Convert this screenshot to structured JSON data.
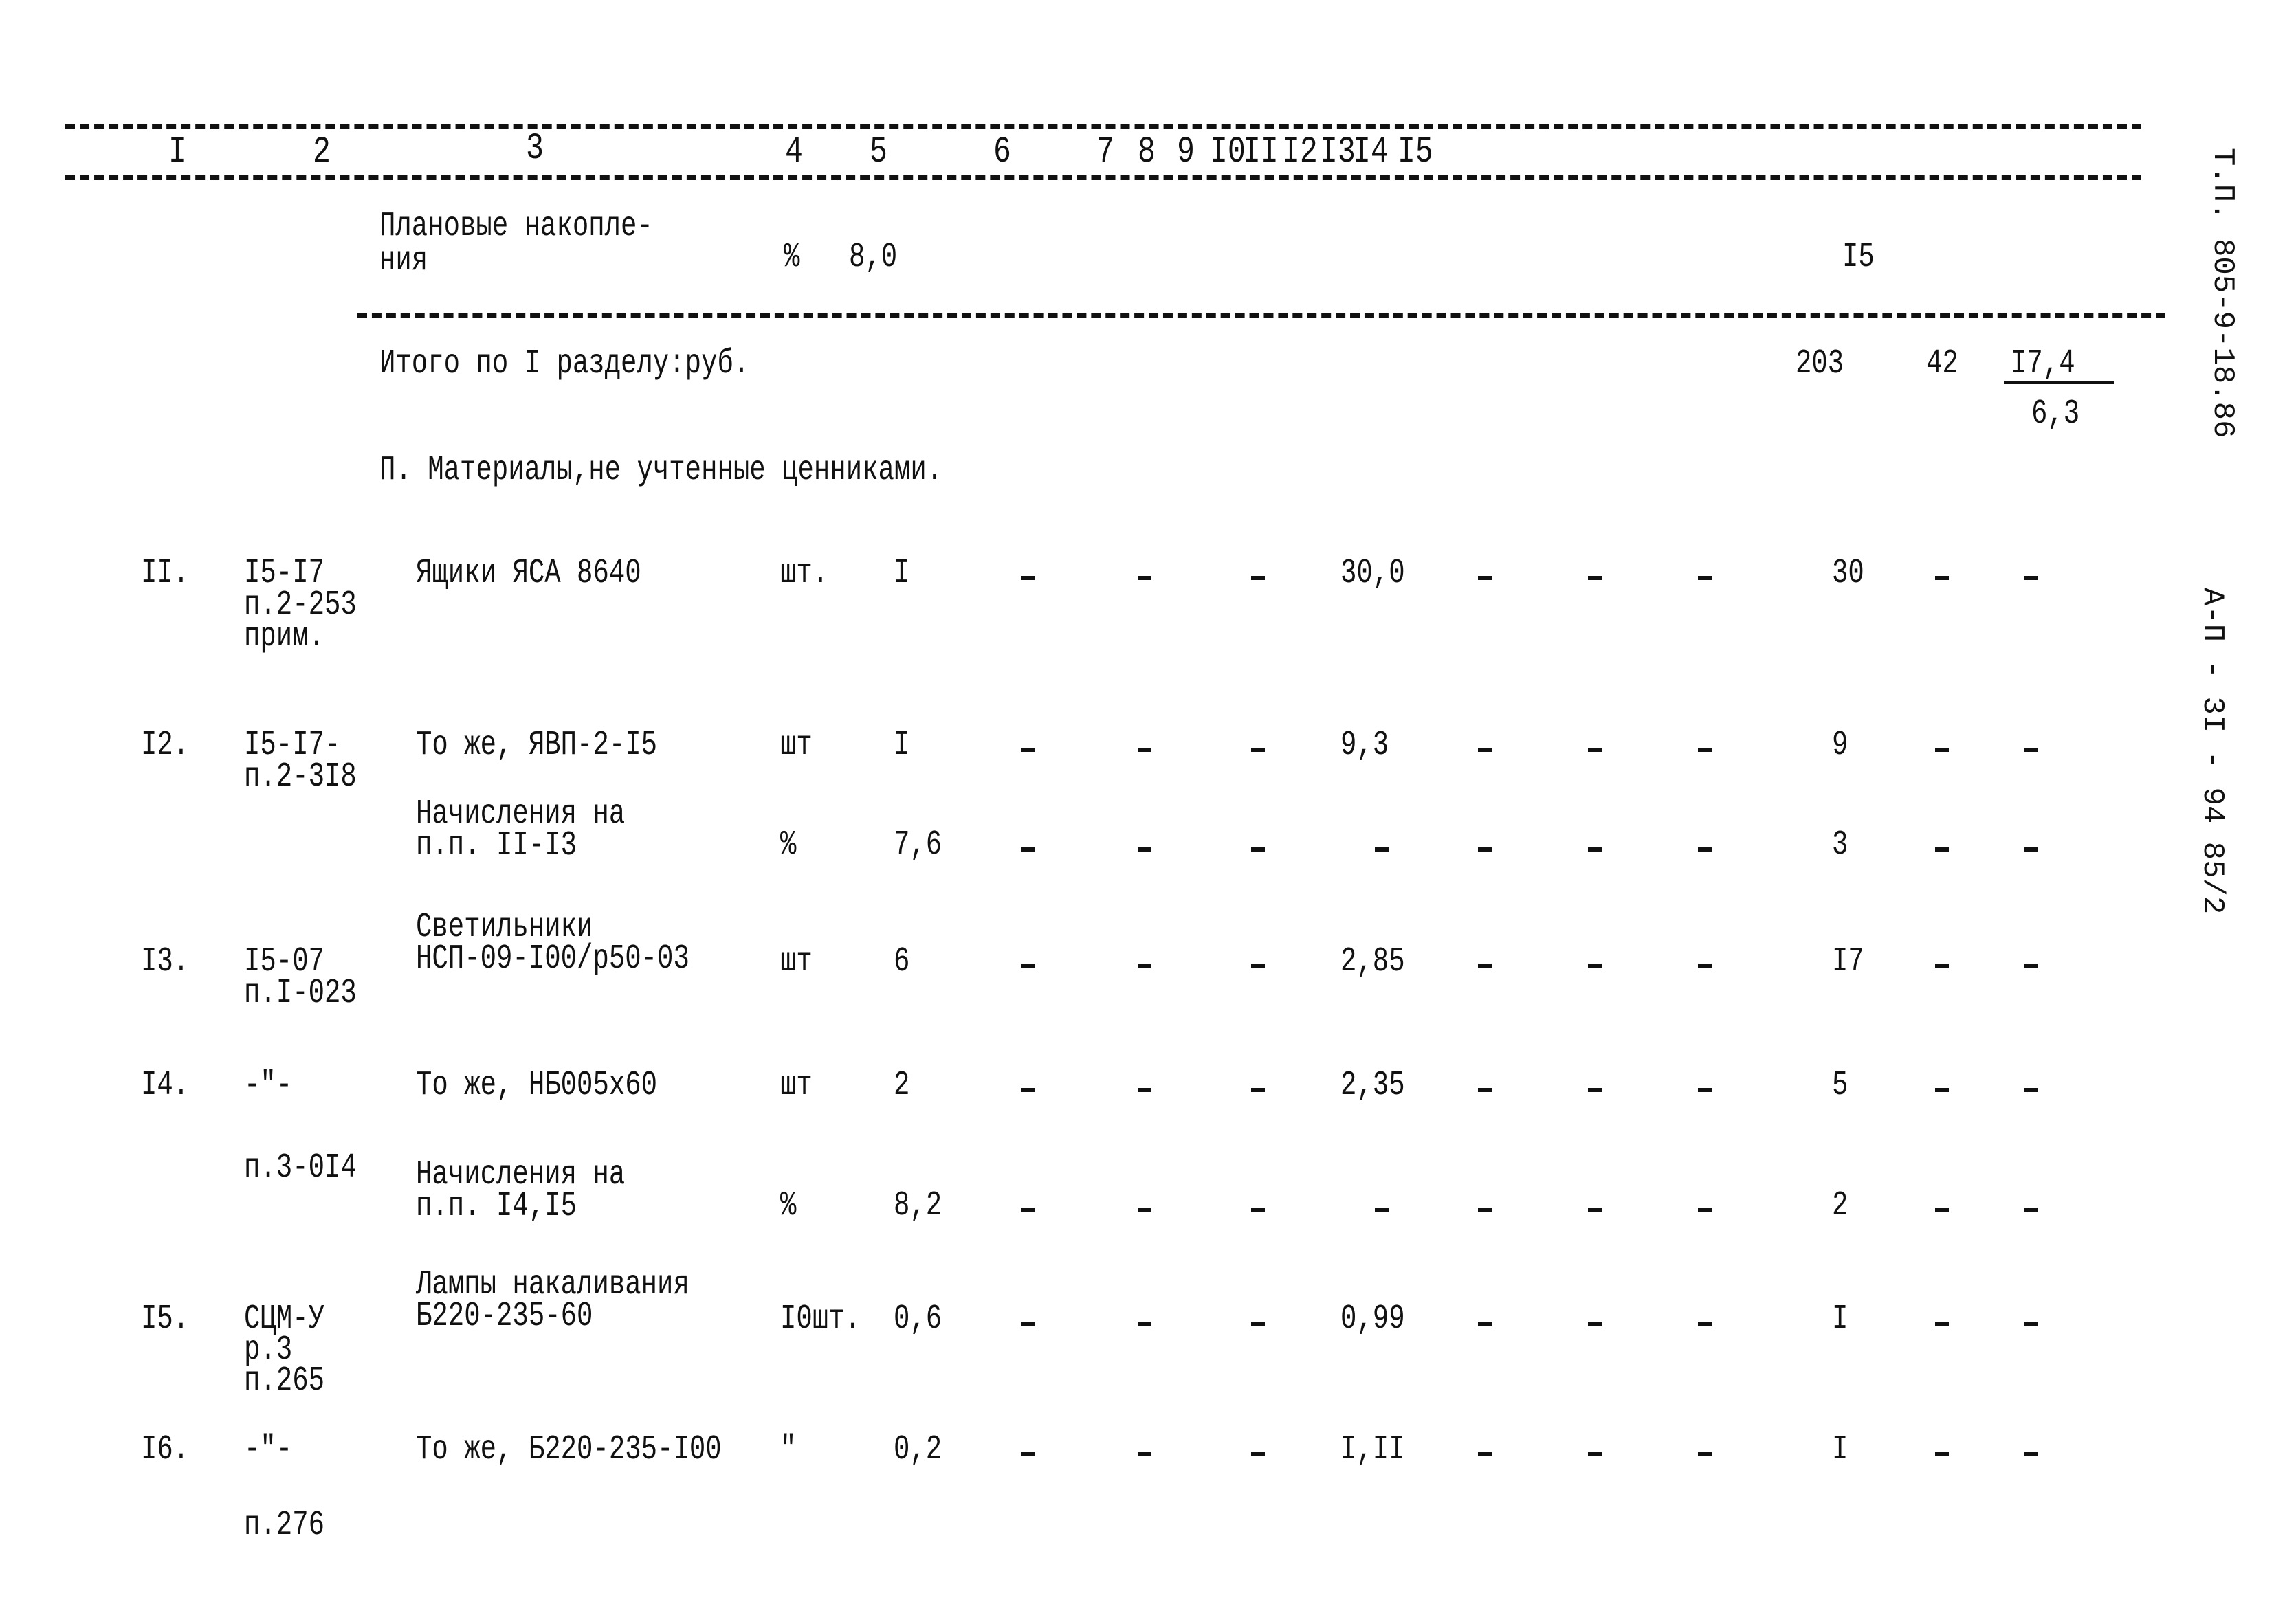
{
  "header": {
    "columns": [
      "I",
      "2",
      "3",
      "4",
      "5",
      "6",
      "7",
      "8",
      "9",
      "I0",
      "II",
      "I2",
      "I3",
      "I4",
      "I5"
    ]
  },
  "side_stamp": {
    "top": "Т.П. 805-9-18.86",
    "bottom": "А-П - 3I - 94 85/2"
  },
  "planned_savings": {
    "label_line1": "Плановые накопле-",
    "label_line2": "ния",
    "unit": "%",
    "qty": "8,0",
    "col13": "I5"
  },
  "total_section1": {
    "label": "Итого по I разделу:руб.",
    "col13": "203",
    "col14": "42",
    "col15_numerator": "I7,4",
    "col15_denominator": "6,3"
  },
  "section2_title": "П. Материалы,не учтенные ценниками.",
  "rows": [
    {
      "num": "II.",
      "code": [
        "I5-I7",
        "п.2-253",
        "прим."
      ],
      "name": [
        "Ящики ЯСА 8640"
      ],
      "unit": "шт.",
      "qty": "I",
      "col9": "30,0",
      "col13": "30"
    },
    {
      "num": "I2.",
      "code": [
        "I5-I7-",
        "п.2-3I8"
      ],
      "name": [
        "То же, ЯВП-2-I5"
      ],
      "unit": "шт",
      "qty": "I",
      "col9": "9,3",
      "col13": "9"
    },
    {
      "num": "",
      "code": [],
      "name": [
        "Начисления на",
        "п.п. II-I3"
      ],
      "unit": "%",
      "qty": "7,6",
      "col9": "",
      "col13": "3"
    },
    {
      "num": "I3.",
      "code": [
        "I5-07",
        "п.I-023"
      ],
      "name": [
        "Светильники",
        "НСП-09-I00/р50-03"
      ],
      "unit": "шт",
      "qty": "6",
      "col9": "2,85",
      "col13": "I7"
    },
    {
      "num": "I4.",
      "code": [
        "-\"-",
        "п.3-0I4"
      ],
      "name": [
        "То же, НБ005х60"
      ],
      "unit": "шт",
      "qty": "2",
      "col9": "2,35",
      "col13": "5"
    },
    {
      "num": "",
      "code": [],
      "name": [
        "Начисления на",
        "п.п. I4,I5"
      ],
      "unit": "%",
      "qty": "8,2",
      "col9": "",
      "col13": "2"
    },
    {
      "num": "I5.",
      "code": [
        "СЦМ-У",
        "р.3",
        "п.265"
      ],
      "name": [
        "Лампы накаливания",
        "Б220-235-60"
      ],
      "unit": "I0шт.",
      "qty": "0,6",
      "col9": "0,99",
      "col13": "I"
    },
    {
      "num": "I6.",
      "code": [
        "-\"-",
        "п.276"
      ],
      "name": [
        "То же, Б220-235-I00"
      ],
      "unit": "\"",
      "qty": "0,2",
      "col9": "I,II",
      "col13": "I"
    }
  ]
}
